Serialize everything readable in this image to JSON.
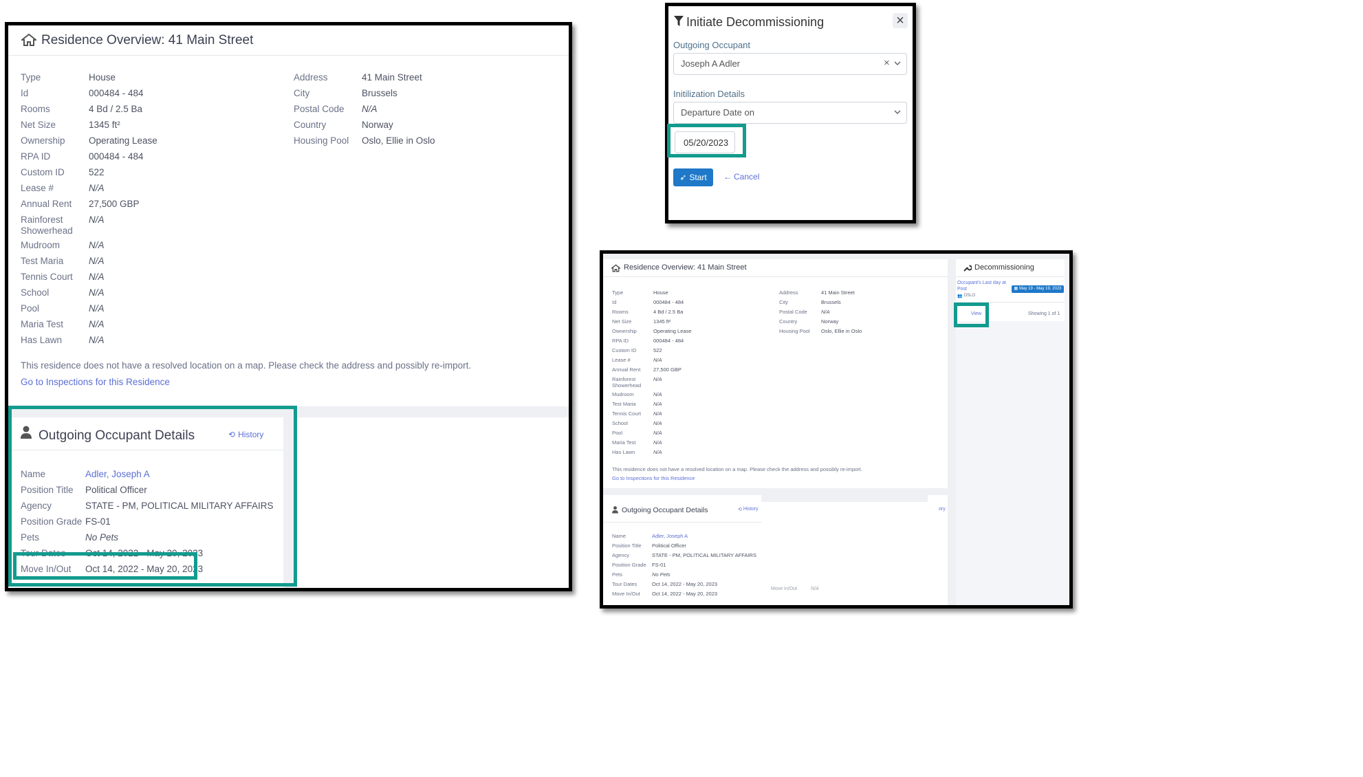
{
  "overview": {
    "title": "Residence Overview: 41 Main Street",
    "left_fields": [
      {
        "label": "Type",
        "value": "House"
      },
      {
        "label": "Id",
        "value": "000484 - 484"
      },
      {
        "label": "Rooms",
        "value": "4 Bd / 2.5 Ba"
      },
      {
        "label": "Net Size",
        "value": "1345 ft²"
      },
      {
        "label": "Ownership",
        "value": "Operating Lease"
      },
      {
        "label": "RPA ID",
        "value": "000484 - 484"
      },
      {
        "label": "Custom ID",
        "value": "522"
      },
      {
        "label": "Lease #",
        "value": "N/A"
      },
      {
        "label": "Annual Rent",
        "value": "27,500 GBP"
      },
      {
        "label": "Rainforest Showerhead",
        "value": "N/A"
      },
      {
        "label": "Mudroom",
        "value": "N/A"
      },
      {
        "label": "Test Maria",
        "value": "N/A"
      },
      {
        "label": "Tennis Court",
        "value": "N/A"
      },
      {
        "label": "School",
        "value": "N/A"
      },
      {
        "label": "Pool",
        "value": "N/A"
      },
      {
        "label": "Maria Test",
        "value": "N/A"
      },
      {
        "label": "Has Lawn",
        "value": "N/A"
      }
    ],
    "right_fields": [
      {
        "label": "Address",
        "value": "41 Main Street"
      },
      {
        "label": "City",
        "value": "Brussels"
      },
      {
        "label": "Postal Code",
        "value": "N/A"
      },
      {
        "label": "Country",
        "value": "Norway"
      },
      {
        "label": "Housing Pool",
        "value": "Oslo, Ellie in Oslo"
      }
    ],
    "map_notice": "This residence does not have a resolved location on a map. Please check the address and possibly re-import.",
    "inspections_link": "Go to Inspections for this Residence"
  },
  "occupant": {
    "title": "Outgoing Occupant Details",
    "history_label": "History",
    "fields": [
      {
        "label": "Name",
        "value": "Adler, Joseph A"
      },
      {
        "label": "Position Title",
        "value": "Political Officer"
      },
      {
        "label": "Agency",
        "value": "STATE - PM, POLITICAL MILITARY AFFAIRS"
      },
      {
        "label": "Position Grade",
        "value": "FS-01"
      },
      {
        "label": "Pets",
        "value": "No Pets"
      },
      {
        "label": "Tour Dates",
        "value": "Oct 14, 2022 - May 20, 2023"
      },
      {
        "label": "Move In/Out",
        "value": "Oct 14, 2022 - May 20, 2023"
      }
    ]
  },
  "modal": {
    "title": "Initiate Decommissioning",
    "close_symbol": "×",
    "outgoing_label": "Outgoing Occupant",
    "outgoing_value": "Joseph A Adler",
    "clear_symbol": "×",
    "init_label": "Initilization Details",
    "init_value": "Departure Date on",
    "date_value": "05/20/2023",
    "start_label": "Start",
    "cancel_label": "Cancel"
  },
  "decom": {
    "title": "Decommissioning",
    "item_text": "Occupant's Last day at Post",
    "item_date": "May 19 - May 19, 2023",
    "item_location": "OSLO",
    "view_label": "View",
    "showing": "Showing 1 of 1",
    "partial_text": "ory",
    "partial_move": "Move In/Out",
    "partial_na": "N/A"
  },
  "colors": {
    "accent": "#129b8e",
    "button": "#1f78c8",
    "link": "#5b6fd6"
  }
}
